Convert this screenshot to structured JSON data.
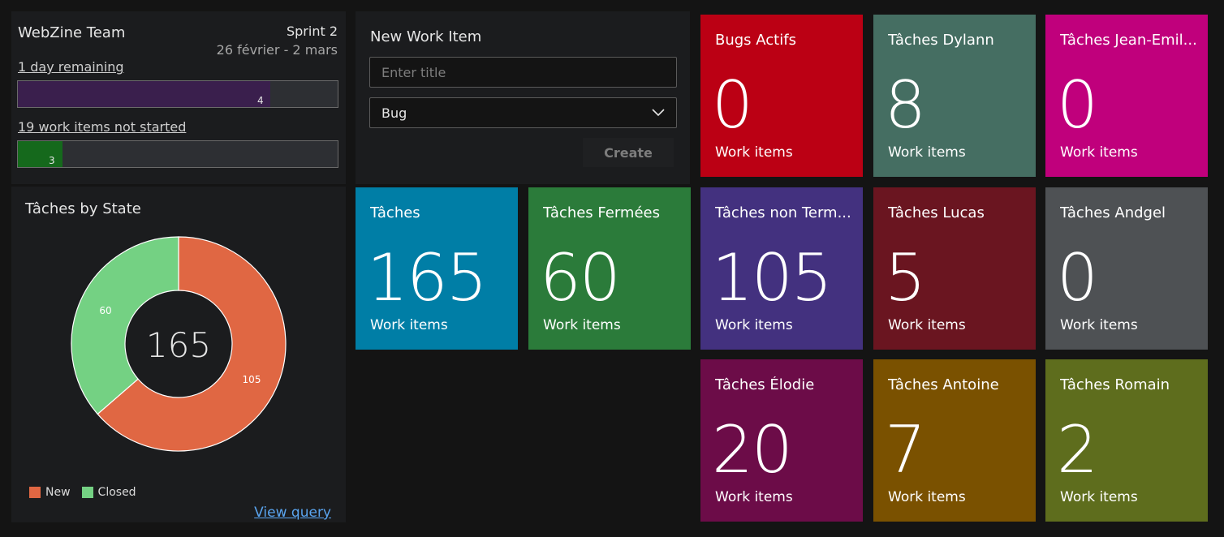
{
  "sprint": {
    "team": "WebZine Team",
    "name": "Sprint 2",
    "dates": "26 février - 2 mars",
    "remaining_link": "1 day remaining",
    "remaining_bar": {
      "value": "4",
      "fraction": 0.79,
      "color": "#3a1f4d"
    },
    "not_started_link": "19 work items not started",
    "not_started_bar": {
      "value": "3",
      "fraction": 0.14,
      "color": "#15691c"
    }
  },
  "donut": {
    "title": "Tâches by State",
    "total": "165",
    "legend": [
      {
        "label": "New",
        "color": "#e06743"
      },
      {
        "label": "Closed",
        "color": "#74d183"
      }
    ],
    "view_query": "View query"
  },
  "chart_data": {
    "type": "pie",
    "title": "Tâches by State",
    "categories": [
      "New",
      "Closed"
    ],
    "values": [
      105,
      60
    ],
    "colors": [
      "#e06743",
      "#74d183"
    ],
    "center_label": "165",
    "legend_position": "bottom-left"
  },
  "new_item": {
    "title": "New Work Item",
    "placeholder": "Enter title",
    "type_value": "Bug",
    "create_label": "Create",
    "chevron_icon": "chevron-down-icon"
  },
  "tiles": [
    {
      "title": "Bugs Actifs",
      "count": "0",
      "sub": "Work items",
      "color": "#bb0014"
    },
    {
      "title": "Tâches Dylann",
      "count": "8",
      "sub": "Work items",
      "color": "#456e62"
    },
    {
      "title": "Tâches Jean-Emil...",
      "count": "0",
      "sub": "Work items",
      "color": "#c0007c"
    },
    {
      "title": "Tâches",
      "count": "165",
      "sub": "Work items",
      "color": "#007ea6"
    },
    {
      "title": "Tâches Fermées",
      "count": "60",
      "sub": "Work items",
      "color": "#2b7b3a"
    },
    {
      "title": "Tâches non Term...",
      "count": "105",
      "sub": "Work items",
      "color": "#43317f"
    },
    {
      "title": "Tâches Lucas",
      "count": "5",
      "sub": "Work items",
      "color": "#6a1520"
    },
    {
      "title": "Tâches Andgel",
      "count": "0",
      "sub": "Work items",
      "color": "#4e5154"
    },
    {
      "title": "Tâches Élodie",
      "count": "20",
      "sub": "Work items",
      "color": "#6c0c48"
    },
    {
      "title": "Tâches Antoine",
      "count": "7",
      "sub": "Work items",
      "color": "#7a5100"
    },
    {
      "title": "Tâches Romain",
      "count": "2",
      "sub": "Work items",
      "color": "#5e6d1d"
    }
  ]
}
